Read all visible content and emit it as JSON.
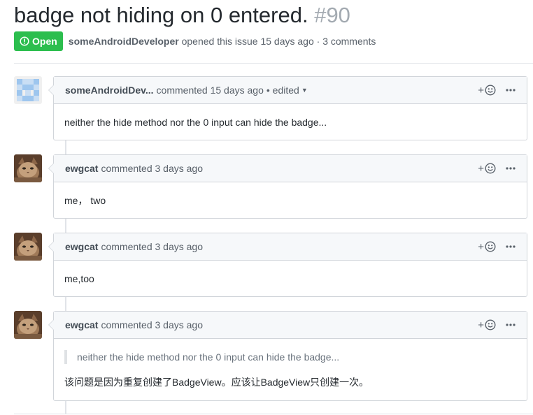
{
  "issue": {
    "title": "badge not hiding on 0 entered.",
    "number": "#90",
    "state": "Open",
    "author": "someAndroidDeveloper",
    "meta_text": "opened this issue 15 days ago · 3 comments"
  },
  "comments": [
    {
      "author": "someAndroidDev...",
      "action": "commented 15 days ago",
      "edited": "• edited",
      "body": "neither the hide method nor the 0 input can hide the badge..."
    },
    {
      "author": "ewgcat",
      "action": "commented 3 days ago",
      "body": "me， two"
    },
    {
      "author": "ewgcat",
      "action": "commented 3 days ago",
      "body": "me,too"
    },
    {
      "author": "ewgcat",
      "action": "commented 3 days ago",
      "quote": "neither the hide method nor the 0 input can hide the badge...",
      "body": "该问题是因为重复创建了BadgeView。应该让BadgeView只创建一次。"
    }
  ],
  "colors": {
    "open_badge": "#2cbe4e",
    "header_bg": "#f6f8fa",
    "border": "#d1d5da",
    "muted_text": "#586069"
  },
  "icons": {
    "state": "issue-opened-icon",
    "reaction": "smiley-icon",
    "more": "kebab-horizontal-icon",
    "edited_menu": "triangle-down-icon"
  }
}
